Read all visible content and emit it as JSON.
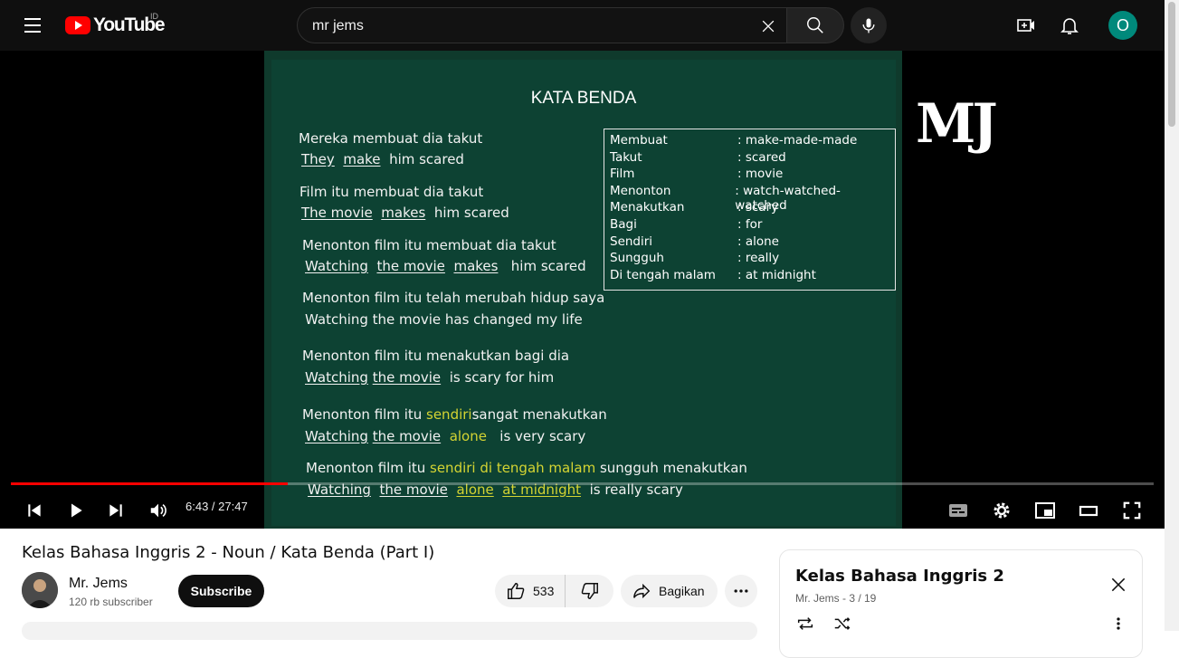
{
  "header": {
    "logo_text": "YouTube",
    "country_code": "ID",
    "search_query": "mr jems"
  },
  "slide": {
    "title": "KATA BENDA",
    "watermark": "MJ",
    "vocab": [
      {
        "id": "Membuat",
        "en": ": make-made-made"
      },
      {
        "id": "Takut",
        "en": ": scared"
      },
      {
        "id": "Film",
        "en": ": movie"
      },
      {
        "id": "Menonton",
        "en": ": watch-watched-watched"
      },
      {
        "id": "Menakutkan",
        "en": ": scary"
      },
      {
        "id": "Bagi",
        "en": ": for"
      },
      {
        "id": "Sendiri",
        "en": ": alone"
      },
      {
        "id": "Sungguh",
        "en": ": really"
      },
      {
        "id": "Di tengah malam",
        "en": ": at midnight"
      }
    ],
    "s1": {
      "id": "Mereka membuat dia takut",
      "a": "They",
      "b": "make",
      "rest": "him  scared"
    },
    "s2": {
      "id": "Film itu membuat dia takut",
      "a": "The movie",
      "b": "makes",
      "rest": "him   scared"
    },
    "s3": {
      "id": "Menonton film itu membuat dia takut",
      "a": "Watching",
      "b": "the movie",
      "c": "makes",
      "rest": "him  scared"
    },
    "s4": {
      "id": "Menonton film itu telah merubah hidup saya",
      "en": "Watching the movie has  changed  my  life"
    },
    "s5": {
      "id": "Menonton film itu menakutkan bagi dia",
      "a": "Watching",
      "b": "the movie",
      "rest": "is  scary  for  him"
    },
    "s6": {
      "id_a": "Menonton film itu ",
      "id_hl": "sendiri",
      "id_b": "sangat menakutkan",
      "a": "Watching",
      "b": "the movie",
      "hl": "alone",
      "rest": "is  very  scary"
    },
    "s7": {
      "id_a": "Menonton film itu ",
      "id_hl": "sendiri di tengah malam",
      "id_b": " sungguh menakutkan",
      "a": "Watching",
      "b": "the movie",
      "hl1": "alone",
      "hl2": "at midnight",
      "rest": "is really scary"
    }
  },
  "player": {
    "time_current": "6:43",
    "time_separator": " / ",
    "time_total": "27:47",
    "progress_fraction": 0.242
  },
  "video": {
    "title": "Kelas Bahasa Inggris 2 - Noun / Kata Benda (Part I)",
    "channel_name": "Mr. Jems",
    "subscriber_count": "120 rb subscriber",
    "subscribe_label": "Subscribe",
    "like_count": "533",
    "share_label": "Bagikan"
  },
  "playlist": {
    "title": "Kelas Bahasa Inggris 2",
    "meta": "Mr. Jems - 3 / 19"
  },
  "colors": {
    "accent": "#ff0000",
    "slide_bg": "#0d4233",
    "highlight": "#d4d433"
  }
}
